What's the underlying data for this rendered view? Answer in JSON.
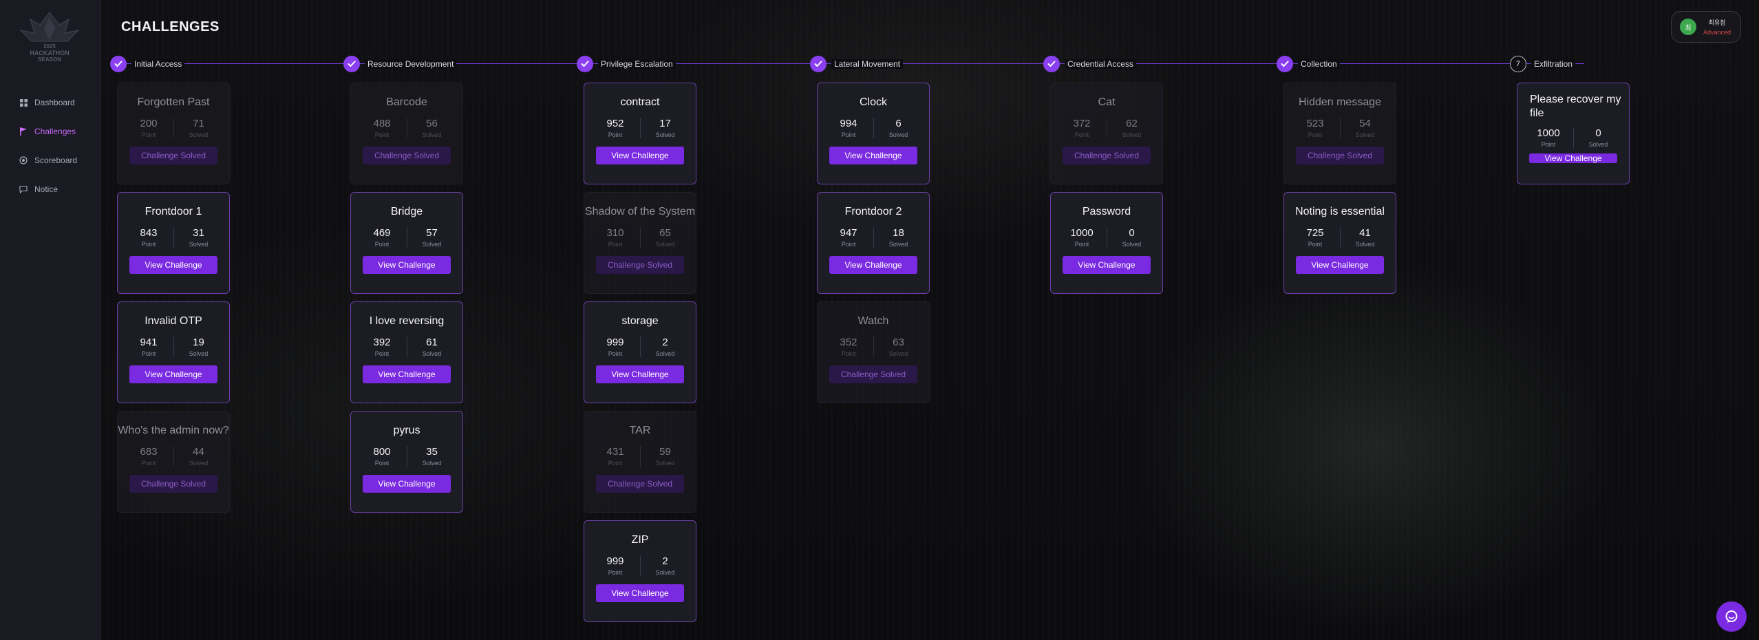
{
  "sidebar": {
    "logo_text": [
      "2025",
      "HACKATHON",
      "SEASON"
    ],
    "items": [
      {
        "label": "Dashboard",
        "icon": "grid-icon",
        "active": false
      },
      {
        "label": "Challenges",
        "icon": "flag-icon",
        "active": true
      },
      {
        "label": "Scoreboard",
        "icon": "target-icon",
        "active": false
      },
      {
        "label": "Notice",
        "icon": "chat-icon",
        "active": false
      }
    ]
  },
  "header": {
    "title": "CHALLENGES",
    "user": {
      "avatar_initial": "최",
      "name": "최유정",
      "level": "Advanced"
    }
  },
  "stages": [
    {
      "label": "Initial Access",
      "done": true
    },
    {
      "label": "Resource Development",
      "done": true
    },
    {
      "label": "Privilege Escalation",
      "done": true
    },
    {
      "label": "Lateral Movement",
      "done": true
    },
    {
      "label": "Credential Access",
      "done": true
    },
    {
      "label": "Collection",
      "done": true
    },
    {
      "label": "Exfiltration",
      "done": false,
      "number": "7"
    }
  ],
  "labels": {
    "point": "Point",
    "solved": "Solved",
    "view": "View Challenge",
    "challenge_solved": "Challenge Solved"
  },
  "columns": [
    [
      {
        "title": "Forgotten Past",
        "points": "200",
        "solves": "71",
        "solved": true
      },
      {
        "title": "Frontdoor 1",
        "points": "843",
        "solves": "31",
        "solved": false
      },
      {
        "title": "Invalid OTP",
        "points": "941",
        "solves": "19",
        "solved": false
      },
      {
        "title": "Who's the admin now?",
        "points": "683",
        "solves": "44",
        "solved": true
      }
    ],
    [
      {
        "title": "Barcode",
        "points": "488",
        "solves": "56",
        "solved": true
      },
      {
        "title": "Bridge",
        "points": "469",
        "solves": "57",
        "solved": false
      },
      {
        "title": "I love reversing",
        "points": "392",
        "solves": "61",
        "solved": false
      },
      {
        "title": "pyrus",
        "points": "800",
        "solves": "35",
        "solved": false
      }
    ],
    [
      {
        "title": "contract",
        "points": "952",
        "solves": "17",
        "solved": false
      },
      {
        "title": "Shadow of the System",
        "points": "310",
        "solves": "65",
        "solved": true
      },
      {
        "title": "storage",
        "points": "999",
        "solves": "2",
        "solved": false
      },
      {
        "title": "TAR",
        "points": "431",
        "solves": "59",
        "solved": true
      },
      {
        "title": "ZIP",
        "points": "999",
        "solves": "2",
        "solved": false
      }
    ],
    [
      {
        "title": "Clock",
        "points": "994",
        "solves": "6",
        "solved": false
      },
      {
        "title": "Frontdoor 2",
        "points": "947",
        "solves": "18",
        "solved": false
      },
      {
        "title": "Watch",
        "points": "352",
        "solves": "63",
        "solved": true
      }
    ],
    [
      {
        "title": "Cat",
        "points": "372",
        "solves": "62",
        "solved": true
      },
      {
        "title": "Password",
        "points": "1000",
        "solves": "0",
        "solved": false
      }
    ],
    [
      {
        "title": "Hidden message",
        "points": "523",
        "solves": "54",
        "solved": true
      },
      {
        "title": "Noting is essential",
        "points": "725",
        "solves": "41",
        "solved": false
      }
    ],
    [
      {
        "title": "Please recover my file",
        "points": "1000",
        "solves": "0",
        "solved": false
      }
    ]
  ],
  "colors": {
    "accent": "#7a2ae0",
    "active_nav": "#c66cf5",
    "card_border": "#6b3fa6",
    "level": "#d94a4a"
  }
}
